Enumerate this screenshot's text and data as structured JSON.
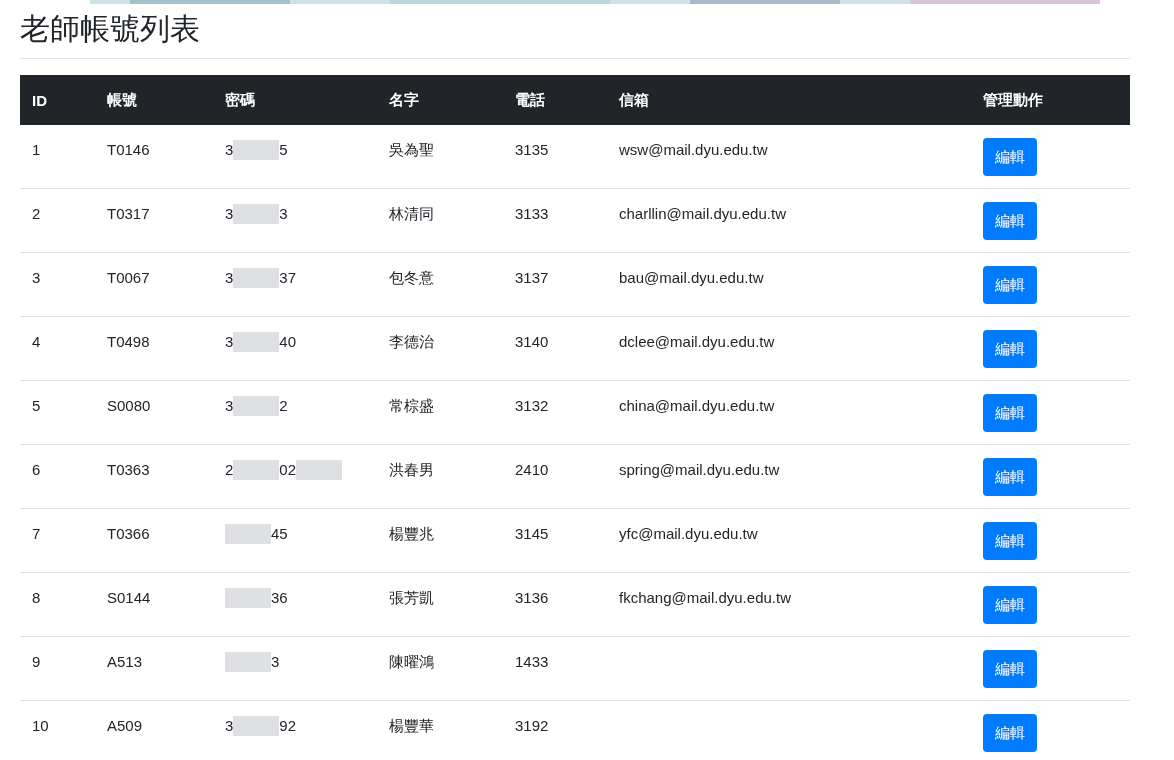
{
  "page": {
    "title": "老師帳號列表"
  },
  "table": {
    "columns": [
      "ID",
      "帳號",
      "密碼",
      "名字",
      "電話",
      "信箱",
      "管理動作"
    ],
    "rows": [
      {
        "id": "1",
        "account": "T0146",
        "password": [
          {
            "kind": "text",
            "text": "3"
          },
          {
            "kind": "redacted"
          },
          {
            "kind": "text",
            "text": "5"
          }
        ],
        "name": "吳為聖",
        "phone": "3135",
        "email": "wsw@mail.dyu.edu.tw",
        "action": "編輯"
      },
      {
        "id": "2",
        "account": "T0317",
        "password": [
          {
            "kind": "text",
            "text": "3"
          },
          {
            "kind": "redacted"
          },
          {
            "kind": "text",
            "text": "3"
          }
        ],
        "name": "林清同",
        "phone": "3133",
        "email": "charllin@mail.dyu.edu.tw",
        "action": "編輯"
      },
      {
        "id": "3",
        "account": "T0067",
        "password": [
          {
            "kind": "text",
            "text": "3"
          },
          {
            "kind": "redacted"
          },
          {
            "kind": "text",
            "text": "37"
          }
        ],
        "name": "包冬意",
        "phone": "3137",
        "email": "bau@mail.dyu.edu.tw",
        "action": "編輯"
      },
      {
        "id": "4",
        "account": "T0498",
        "password": [
          {
            "kind": "text",
            "text": "3"
          },
          {
            "kind": "redacted"
          },
          {
            "kind": "text",
            "text": "40"
          }
        ],
        "name": "李德治",
        "phone": "3140",
        "email": "dclee@mail.dyu.edu.tw",
        "action": "編輯"
      },
      {
        "id": "5",
        "account": "S0080",
        "password": [
          {
            "kind": "text",
            "text": "3"
          },
          {
            "kind": "redacted"
          },
          {
            "kind": "text",
            "text": "2"
          }
        ],
        "name": "常棕盛",
        "phone": "3132",
        "email": "china@mail.dyu.edu.tw",
        "action": "編輯"
      },
      {
        "id": "6",
        "account": "T0363",
        "password": [
          {
            "kind": "text",
            "text": "2"
          },
          {
            "kind": "redacted"
          },
          {
            "kind": "text",
            "text": "02"
          },
          {
            "kind": "redacted"
          }
        ],
        "name": "洪春男",
        "phone": "2410",
        "email": "spring@mail.dyu.edu.tw",
        "action": "編輯"
      },
      {
        "id": "7",
        "account": "T0366",
        "password": [
          {
            "kind": "redacted"
          },
          {
            "kind": "text",
            "text": "45"
          }
        ],
        "name": "楊豐兆",
        "phone": "3145",
        "email": "yfc@mail.dyu.edu.tw",
        "action": "編輯"
      },
      {
        "id": "8",
        "account": "S0144",
        "password": [
          {
            "kind": "redacted"
          },
          {
            "kind": "text",
            "text": "36"
          }
        ],
        "name": "張芳凱",
        "phone": "3136",
        "email": "fkchang@mail.dyu.edu.tw",
        "action": "編輯"
      },
      {
        "id": "9",
        "account": "A513",
        "password": [
          {
            "kind": "redacted"
          },
          {
            "kind": "text",
            "text": "3"
          }
        ],
        "name": "陳曜鴻",
        "phone": "1433",
        "action": "編輯"
      },
      {
        "id": "10",
        "account": "A509",
        "password": [
          {
            "kind": "text",
            "text": "3"
          },
          {
            "kind": "redacted"
          },
          {
            "kind": "text",
            "text": "92"
          }
        ],
        "name": "楊豐華",
        "phone": "3192",
        "action": "編輯"
      }
    ]
  }
}
